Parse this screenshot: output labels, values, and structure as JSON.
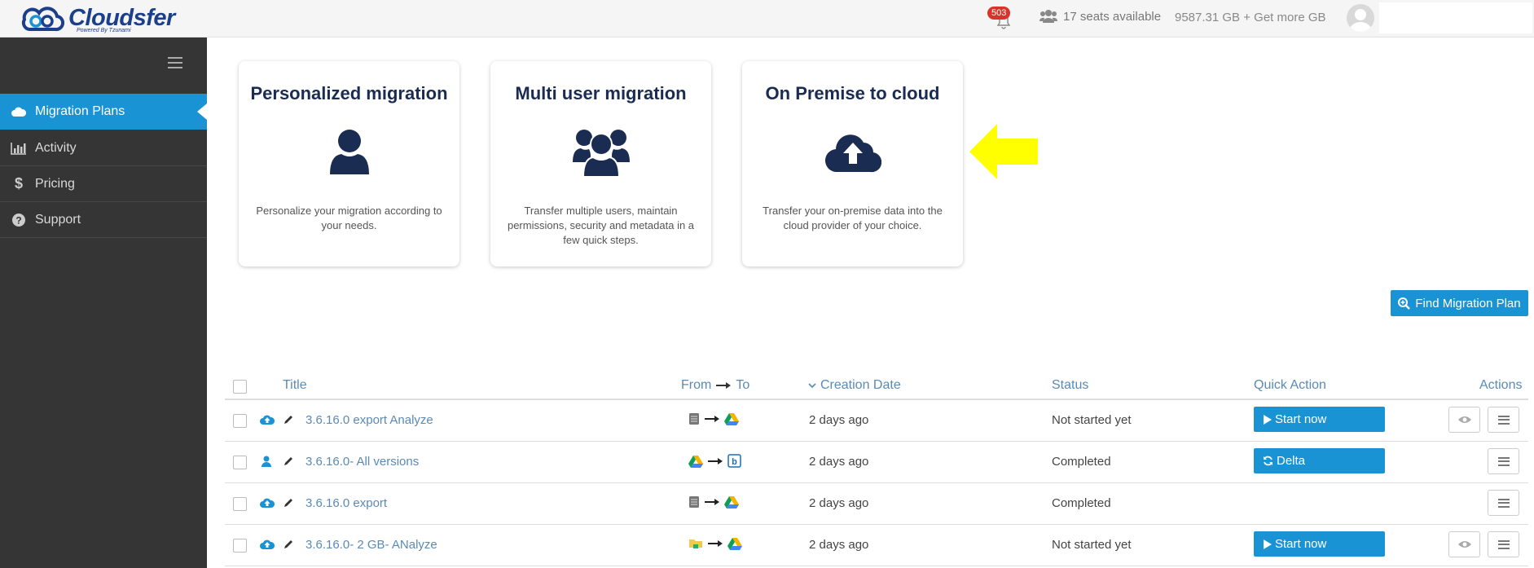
{
  "header": {
    "logo_text": "Cloudsfer",
    "logo_sub": "Powered By Tzunami",
    "notification_count": "503",
    "seats": "17 seats available",
    "storage": "9587.31 GB + Get more GB"
  },
  "sidebar": {
    "items": [
      {
        "label": "Migration Plans",
        "icon": "cloud-icon"
      },
      {
        "label": "Activity",
        "icon": "bar-chart-icon"
      },
      {
        "label": "Pricing",
        "icon": "dollar-icon"
      },
      {
        "label": "Support",
        "icon": "question-circle-icon"
      }
    ]
  },
  "cards": [
    {
      "title": "Personalized migration",
      "desc": "Personalize your migration according to your needs."
    },
    {
      "title": "Multi user migration",
      "desc": "Transfer multiple users, maintain permissions, security and metadata in a few quick steps."
    },
    {
      "title": "On Premise to cloud",
      "desc": "Transfer your on-premise data into the cloud provider of your choice."
    }
  ],
  "find_button": "Find Migration Plan",
  "table": {
    "headers": {
      "title": "Title",
      "from": "From",
      "to": "To",
      "creation_date": "Creation Date",
      "status": "Status",
      "quick_action": "Quick Action",
      "actions": "Actions"
    },
    "rows": [
      {
        "title": "3.6.16.0 export Analyze",
        "date": "2 days ago",
        "status": "Not started yet",
        "quick_action": "Start now",
        "from_icon": "server-icon",
        "to_icon": "google-drive-icon",
        "type_icon": "cloud-upload-icon"
      },
      {
        "title": "3.6.16.0- All versions",
        "date": "2 days ago",
        "status": "Completed",
        "quick_action": "Delta",
        "from_icon": "google-drive-icon",
        "to_icon": "box-icon",
        "type_icon": "user-icon"
      },
      {
        "title": "3.6.16.0 export",
        "date": "2 days ago",
        "status": "Completed",
        "quick_action": "",
        "from_icon": "server-icon",
        "to_icon": "google-drive-icon",
        "type_icon": "cloud-upload-icon"
      },
      {
        "title": "3.6.16.0- 2 GB- ANalyze",
        "date": "2 days ago",
        "status": "Not started yet",
        "quick_action": "Start now",
        "from_icon": "folder-network-icon",
        "to_icon": "google-drive-icon",
        "type_icon": "cloud-upload-icon"
      }
    ]
  },
  "colors": {
    "accent": "#1a93d5",
    "sidebar_bg": "#353535",
    "navy": "#1b2c52",
    "link": "#5a8ab5",
    "arrow": "#ffff00"
  }
}
